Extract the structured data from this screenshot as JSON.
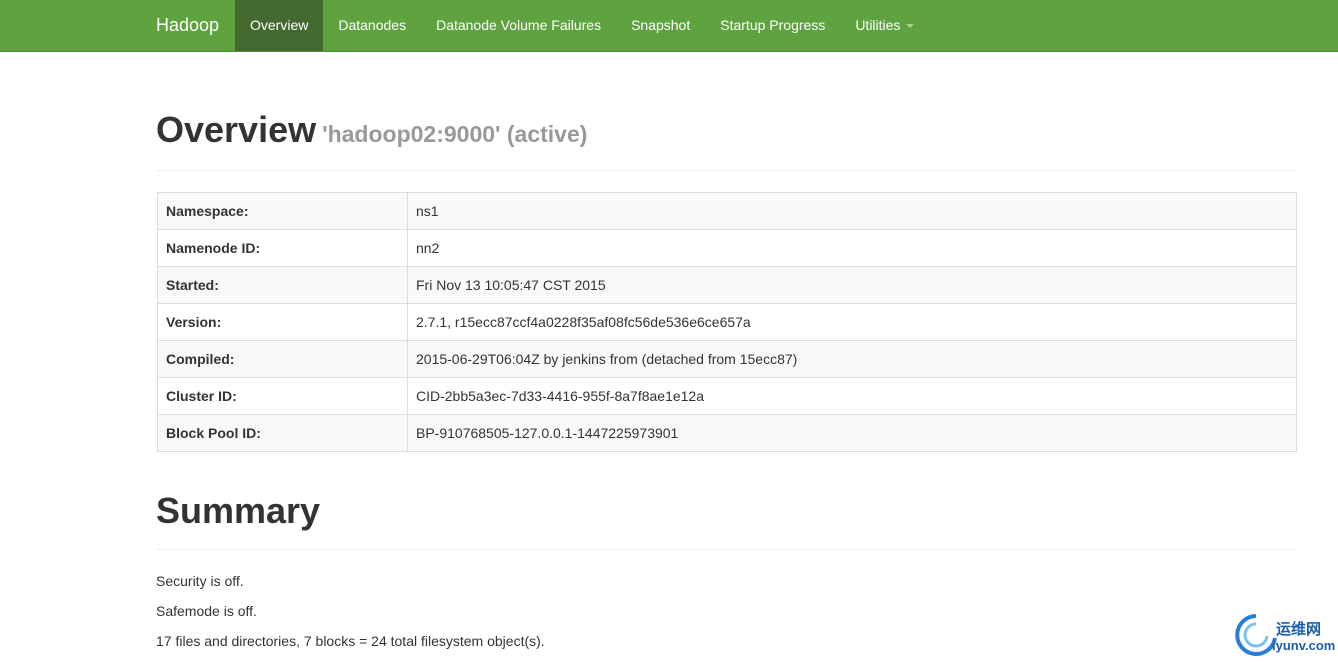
{
  "navbar": {
    "brand": "Hadoop",
    "items": [
      {
        "label": "Overview",
        "active": true
      },
      {
        "label": "Datanodes"
      },
      {
        "label": "Datanode Volume Failures"
      },
      {
        "label": "Snapshot"
      },
      {
        "label": "Startup Progress"
      },
      {
        "label": "Utilities",
        "dropdown": true
      }
    ]
  },
  "overview": {
    "title": "Overview",
    "subtitle": "'hadoop02:9000' (active)",
    "rows": [
      {
        "key": "Namespace:",
        "value": "ns1"
      },
      {
        "key": "Namenode ID:",
        "value": "nn2"
      },
      {
        "key": "Started:",
        "value": "Fri Nov 13 10:05:47 CST 2015"
      },
      {
        "key": "Version:",
        "value": "2.7.1, r15ecc87ccf4a0228f35af08fc56de536e6ce657a"
      },
      {
        "key": "Compiled:",
        "value": "2015-06-29T06:04Z by jenkins from (detached from 15ecc87)"
      },
      {
        "key": "Cluster ID:",
        "value": "CID-2bb5a3ec-7d33-4416-955f-8a7f8ae1e12a"
      },
      {
        "key": "Block Pool ID:",
        "value": "BP-910768505-127.0.0.1-1447225973901"
      }
    ]
  },
  "summary": {
    "title": "Summary",
    "lines": [
      "Security is off.",
      "Safemode is off.",
      "17 files and directories, 7 blocks = 24 total filesystem object(s)."
    ]
  },
  "watermark": {
    "line1": "运维网",
    "line2": "iyunv.com"
  },
  "colors": {
    "navbar": "#5fa341",
    "navbar_active": "#44692f",
    "subtitle": "#999999"
  }
}
